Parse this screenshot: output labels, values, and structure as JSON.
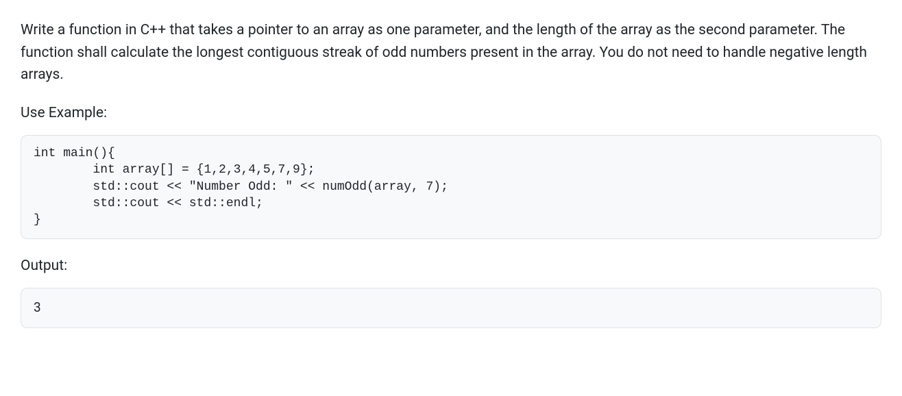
{
  "problem": {
    "description": "Write a function in C++ that takes a pointer to an array as one parameter, and the length of the array as the second parameter. The function shall calculate the longest contiguous streak of odd numbers present in the array. You do not need to handle negative length arrays."
  },
  "example": {
    "heading": "Use Example:",
    "code": "int main(){\n        int array[] = {1,2,3,4,5,7,9};\n        std::cout << \"Number Odd: \" << numOdd(array, 7);\n        std::cout << std::endl;\n}"
  },
  "output": {
    "heading": "Output:",
    "value": "3"
  }
}
